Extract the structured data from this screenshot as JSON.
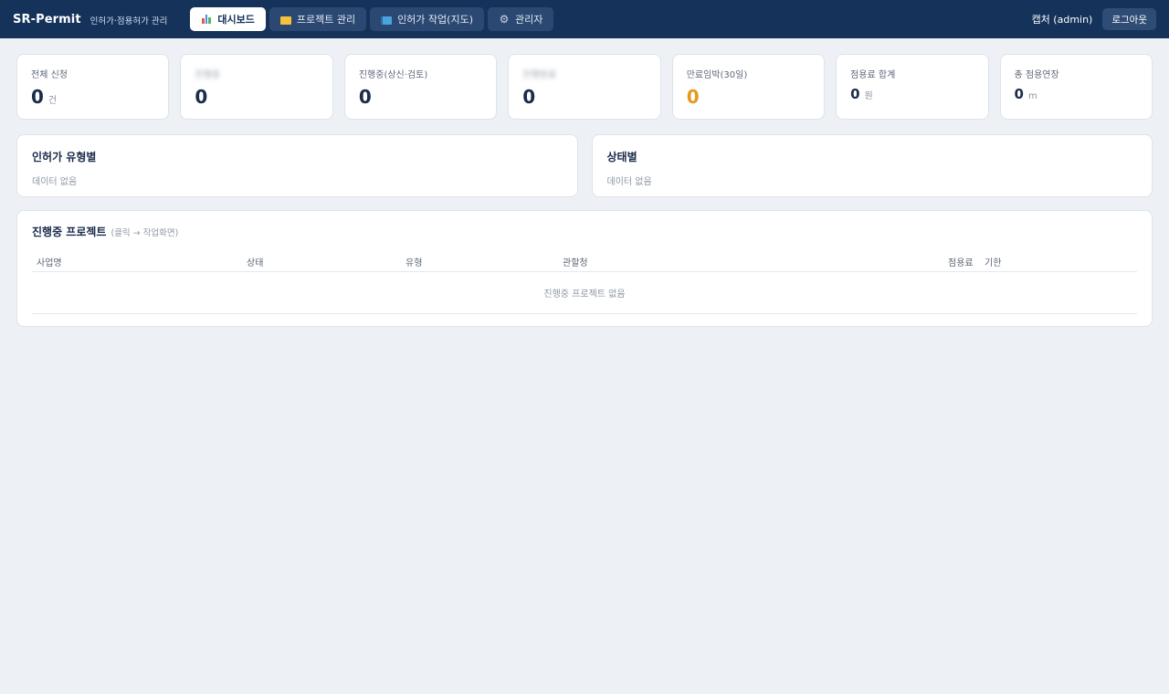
{
  "header": {
    "brand": "SR-Permit",
    "subtitle": "인허가·점용허가 관리",
    "tabs": [
      {
        "label": "대시보드",
        "icon": "bar-chart-icon",
        "active": true
      },
      {
        "label": "프로젝트 관리",
        "icon": "folder-icon",
        "active": false
      },
      {
        "label": "인허가 작업(지도)",
        "icon": "map-book-icon",
        "active": false
      },
      {
        "label": "관리자",
        "icon": "gear-icon",
        "active": false
      }
    ],
    "user_label": "캡처 (admin)",
    "logout_label": "로그아웃"
  },
  "stats": [
    {
      "label": "전체 신청",
      "value": "0",
      "unit": "건",
      "blurred": false
    },
    {
      "label": "진행중",
      "value": "0",
      "unit": "",
      "blurred": true
    },
    {
      "label": "진행중(상신·검토)",
      "value": "0",
      "unit": "",
      "blurred": false
    },
    {
      "label": "진행완료",
      "value": "0",
      "unit": "",
      "blurred": true
    },
    {
      "label": "만료임박(30일)",
      "value": "0",
      "unit": "",
      "blurred": false,
      "accent": "#e59a1f"
    },
    {
      "label": "점용료 합계",
      "value": "0",
      "unit": "원",
      "blurred": false
    },
    {
      "label": "총 점용연장",
      "value": "0",
      "unit": "m",
      "blurred": false
    }
  ],
  "panels": {
    "by_type": {
      "title": "인허가 유형별",
      "empty": "데이터 없음"
    },
    "by_status": {
      "title": "상태별",
      "empty": "데이터 없음"
    }
  },
  "projects": {
    "title": "진행중 프로젝트",
    "hint": "(클릭 → 작업화면)",
    "columns": [
      "사업명",
      "상태",
      "유형",
      "관할청",
      "점용료",
      "기한"
    ],
    "empty": "진행중 프로젝트 없음"
  },
  "colors": {
    "topbar": "#14325a",
    "background": "#edf1f6",
    "accent_warning": "#e59a1f",
    "value_text": "#1a2b4c"
  }
}
